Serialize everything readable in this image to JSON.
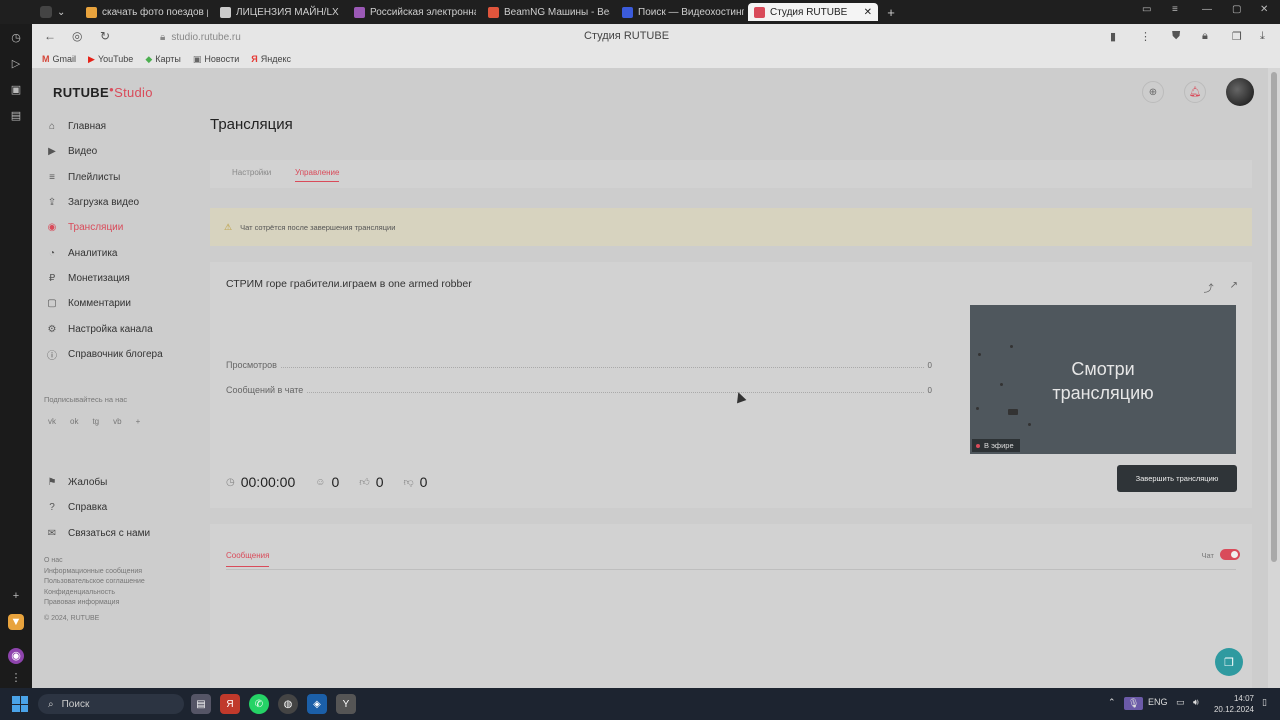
{
  "browser": {
    "tabs": [
      {
        "title": "скачать фото поездов ра",
        "color": "#e8a33d"
      },
      {
        "title": "ЛИЦЕНЗИЯ МАЙН/LX S",
        "color": "#cccccc"
      },
      {
        "title": "Российская электронная",
        "color": "#9b59b6"
      },
      {
        "title": "BeamNG Машины - Beam",
        "color": "#e0553c"
      },
      {
        "title": "Поиск — Видеохостинг R",
        "color": "#3b5bdb"
      },
      {
        "title": "Студия RUTUBE",
        "color": "#d94b5a"
      }
    ],
    "url": "studio.rutube.ru",
    "page_title": "Студия RUTUBE",
    "bookmarks": [
      {
        "label": "Gmail",
        "icon": "M",
        "color": "#d44638"
      },
      {
        "label": "YouTube",
        "icon": "▶",
        "color": "#e62117"
      },
      {
        "label": "Карты",
        "icon": "◆",
        "color": "#4caf50"
      },
      {
        "label": "Новости",
        "icon": "▣",
        "color": "#666666"
      },
      {
        "label": "Яндекс",
        "icon": "Я",
        "color": "#e53935"
      }
    ]
  },
  "logo": {
    "brand": "RUTUBE",
    "suffix": "Studio"
  },
  "sidebar": {
    "items": [
      {
        "label": "Главная",
        "icon": "⌂"
      },
      {
        "label": "Видео",
        "icon": "▶"
      },
      {
        "label": "Плейлисты",
        "icon": "≡"
      },
      {
        "label": "Загрузка видео",
        "icon": "⇪"
      },
      {
        "label": "Трансляции",
        "icon": "◉"
      },
      {
        "label": "Аналитика",
        "icon": "◔"
      },
      {
        "label": "Монетизация",
        "icon": "₽"
      },
      {
        "label": "Комментарии",
        "icon": "▢"
      },
      {
        "label": "Настройка канала",
        "icon": "⚙"
      },
      {
        "label": "Справочник блогера",
        "icon": "ⓘ"
      }
    ],
    "follow_label": "Подписывайтесь на нас",
    "socials": [
      "vk",
      "ok",
      "tg",
      "vb",
      "+"
    ],
    "items2": [
      {
        "label": "Жалобы",
        "icon": "⚑"
      },
      {
        "label": "Справка",
        "icon": "?"
      },
      {
        "label": "Связаться с нами",
        "icon": "✉"
      }
    ],
    "footer_links": [
      "О нас",
      "Информационные сообщения",
      "Пользовательское соглашение",
      "Конфиденциальность",
      "Правовая информация",
      "© 2024, RUTUBE"
    ]
  },
  "main": {
    "title": "Трансляция",
    "tabs": [
      "Настройки",
      "Управление"
    ],
    "warning": "Чат сотрётся после завершения трансляции",
    "stream": {
      "title": "СТРИМ горе грабители.играем в one armed robber",
      "stats": [
        {
          "label": "Просмотров",
          "value": "0"
        },
        {
          "label": "Сообщений в чате",
          "value": "0"
        }
      ],
      "timer": "00:00:00",
      "viewers": "0",
      "likes": "0",
      "dislikes": "0",
      "preview_line1": "Смотри",
      "preview_line2": "трансляцию",
      "live_label": "В эфире",
      "end_button": "Завершить трансляцию"
    },
    "chat": {
      "tab": "Сообщения",
      "toggle_label": "Чат"
    }
  },
  "taskbar": {
    "search": "Поиск",
    "lang": "ENG",
    "time": "14:07",
    "date": "20.12.2024"
  }
}
